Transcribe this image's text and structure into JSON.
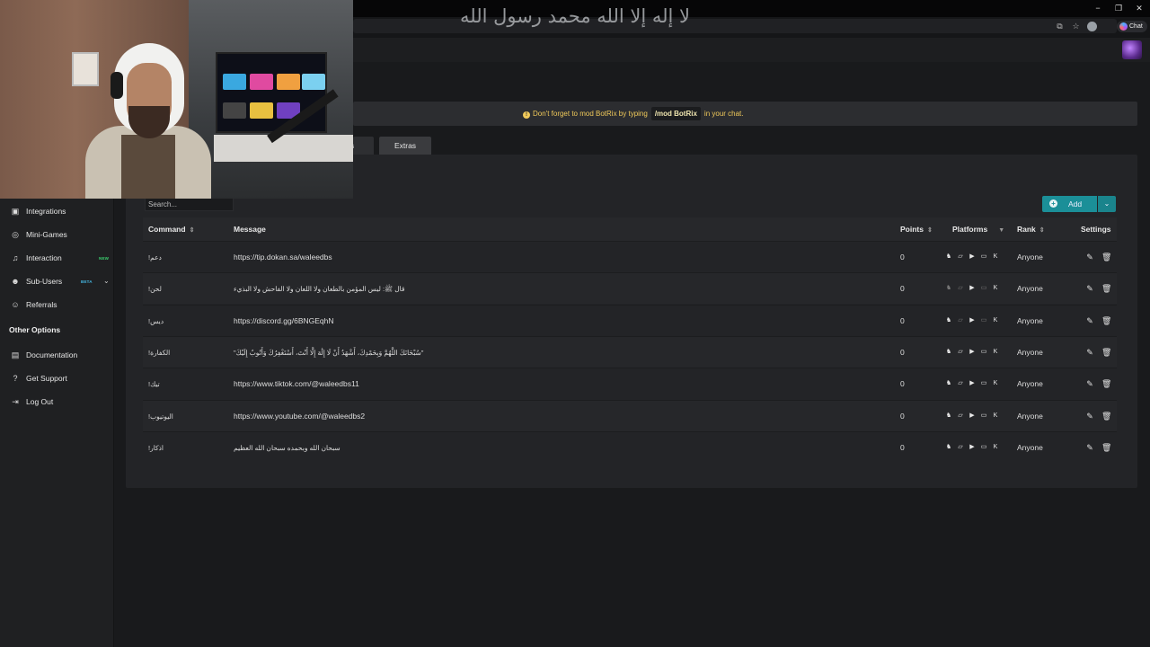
{
  "overlay_text": "لا إله إلا الله محمد رسول الله",
  "browser": {
    "minimize_glyph": "−",
    "restore_glyph": "❐",
    "close_glyph": "✕",
    "ext_glyph": "⧉",
    "fav_glyph": "☆",
    "chat_label": "Chat"
  },
  "sidebar": {
    "items": [
      {
        "label": "Integrations",
        "icon": "integrations-icon",
        "glyph": "▣"
      },
      {
        "label": "Mini-Games",
        "icon": "gamepad-icon",
        "glyph": "◎"
      },
      {
        "label": "Interaction",
        "icon": "music-note-icon",
        "glyph": "♫",
        "badge": "NEW"
      },
      {
        "label": "Sub-Users",
        "icon": "users-icon",
        "glyph": "☻",
        "badge": "BETA"
      },
      {
        "label": "Referrals",
        "icon": "referrals-icon",
        "glyph": "☺"
      }
    ],
    "other_heading": "Other Options",
    "other_items": [
      {
        "label": "Documentation",
        "icon": "book-icon",
        "glyph": "▤"
      },
      {
        "label": "Get Support",
        "icon": "question-icon",
        "glyph": "?"
      },
      {
        "label": "Log Out",
        "icon": "logout-icon",
        "glyph": "⇥"
      }
    ]
  },
  "notice": {
    "pre": "Don't forget to mod BotRix by typing",
    "code": "/mod BotRix",
    "post": "in your chat.",
    "glyph": "!"
  },
  "tabs": {
    "partial": "rs",
    "extras": "Extras"
  },
  "search": {
    "placeholder": "Search..."
  },
  "add_button": {
    "label": "Add",
    "glyph": "+",
    "dropdown_glyph": "⌄"
  },
  "table": {
    "headers": {
      "command": "Command",
      "message": "Message",
      "points": "Points",
      "platforms": "Platforms",
      "rank": "Rank",
      "settings": "Settings",
      "sort_glyph": "⇕",
      "filter_glyph": "▼"
    },
    "rows": [
      {
        "command": "دعم!",
        "message": "https://tip.dokan.sa/waleedbs",
        "points": "0",
        "rank": "Anyone",
        "ar": false,
        "dim": [
          false,
          false,
          false,
          false,
          false
        ]
      },
      {
        "command": "لحن!",
        "message": "قال ﷺ: ليس المؤمن بالطعان ولا اللعان ولا الفاحش ولا البذيء",
        "points": "0",
        "rank": "Anyone",
        "ar": true,
        "dim": [
          true,
          true,
          false,
          true,
          false
        ]
      },
      {
        "command": "ديس!",
        "message": "https://discord.gg/6BNGEqhN",
        "points": "0",
        "rank": "Anyone",
        "ar": false,
        "dim": [
          false,
          true,
          false,
          true,
          false
        ]
      },
      {
        "command": "الكفارة!",
        "message": "\"سُبْحَانَكَ اللَّهُمَّ وَبِحَمْدِكَ، أَشْهَدُ أَنْ لَا إِلَٰهَ إِلَّا أَنْتَ، أَسْتَغْفِرُكَ وَأَتُوبُ إِلَيْكَ\"",
        "points": "0",
        "rank": "Anyone",
        "ar": true,
        "dim": [
          false,
          false,
          false,
          false,
          false
        ]
      },
      {
        "command": "تيك!",
        "message": "https://www.tiktok.com/@waleedbs11",
        "points": "0",
        "rank": "Anyone",
        "ar": false,
        "dim": [
          false,
          false,
          false,
          false,
          false
        ]
      },
      {
        "command": "اليوتيوب!",
        "message": "https://www.youtube.com/@waleedbs2",
        "points": "0",
        "rank": "Anyone",
        "ar": false,
        "dim": [
          false,
          false,
          false,
          false,
          false
        ]
      },
      {
        "command": "اذكار!",
        "message": "سبحان الله وبحمده سبحان الله العظيم",
        "points": "0",
        "rank": "Anyone",
        "ar": true,
        "dim": [
          false,
          false,
          false,
          false,
          false
        ]
      }
    ],
    "platform_icons": [
      {
        "name": "botrix-icon",
        "glyph": "♞"
      },
      {
        "name": "twitch-icon",
        "glyph": "▱"
      },
      {
        "name": "youtube-icon",
        "glyph": "▶"
      },
      {
        "name": "trovo-icon",
        "glyph": "▭"
      },
      {
        "name": "kick-icon",
        "glyph": "K"
      }
    ],
    "edit_glyph": "✎",
    "delete_glyph": "🗑"
  }
}
